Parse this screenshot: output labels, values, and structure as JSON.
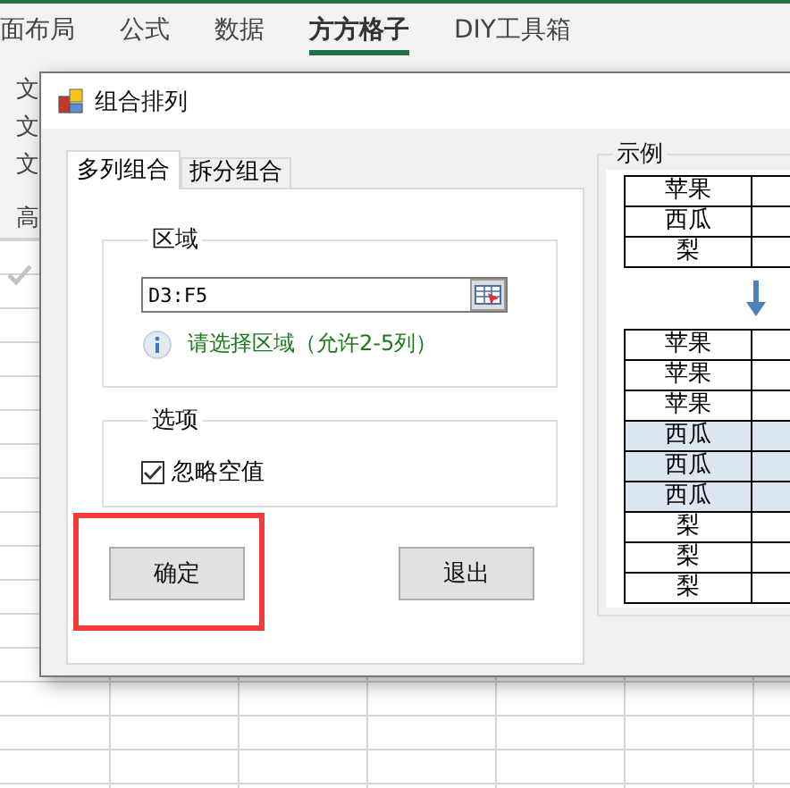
{
  "ribbon_tabs": [
    {
      "label": "面布局",
      "selected": false
    },
    {
      "label": "公式",
      "selected": false
    },
    {
      "label": "数据",
      "selected": false
    },
    {
      "label": "方方格子",
      "selected": true
    },
    {
      "label": "DIY工具箱",
      "selected": false
    }
  ],
  "ribbon_fragments": [
    "文",
    "文",
    "文",
    "高"
  ],
  "dialog": {
    "title": "组合排列",
    "tabs": [
      {
        "label": "多列组合",
        "selected": true
      },
      {
        "label": "拆分组合",
        "selected": false
      }
    ],
    "region": {
      "legend": "区域",
      "value": "D3:F5",
      "hint": "请选择区域（允许2-5列）"
    },
    "options": {
      "legend": "选项",
      "checkbox": {
        "label": "忽略空值",
        "checked": true
      }
    },
    "buttons": [
      {
        "label": "确定",
        "highlighted": true
      },
      {
        "label": "退出",
        "highlighted": false
      }
    ],
    "example": {
      "legend": "示例",
      "before": [
        "苹果",
        "西瓜",
        "梨"
      ],
      "after": [
        {
          "text": "苹果",
          "shaded": false
        },
        {
          "text": "苹果",
          "shaded": false
        },
        {
          "text": "苹果",
          "shaded": false
        },
        {
          "text": "西瓜",
          "shaded": true
        },
        {
          "text": "西瓜",
          "shaded": true
        },
        {
          "text": "西瓜",
          "shaded": true
        },
        {
          "text": "梨",
          "shaded": false
        },
        {
          "text": "梨",
          "shaded": false
        },
        {
          "text": "梨",
          "shaded": false
        }
      ]
    }
  }
}
